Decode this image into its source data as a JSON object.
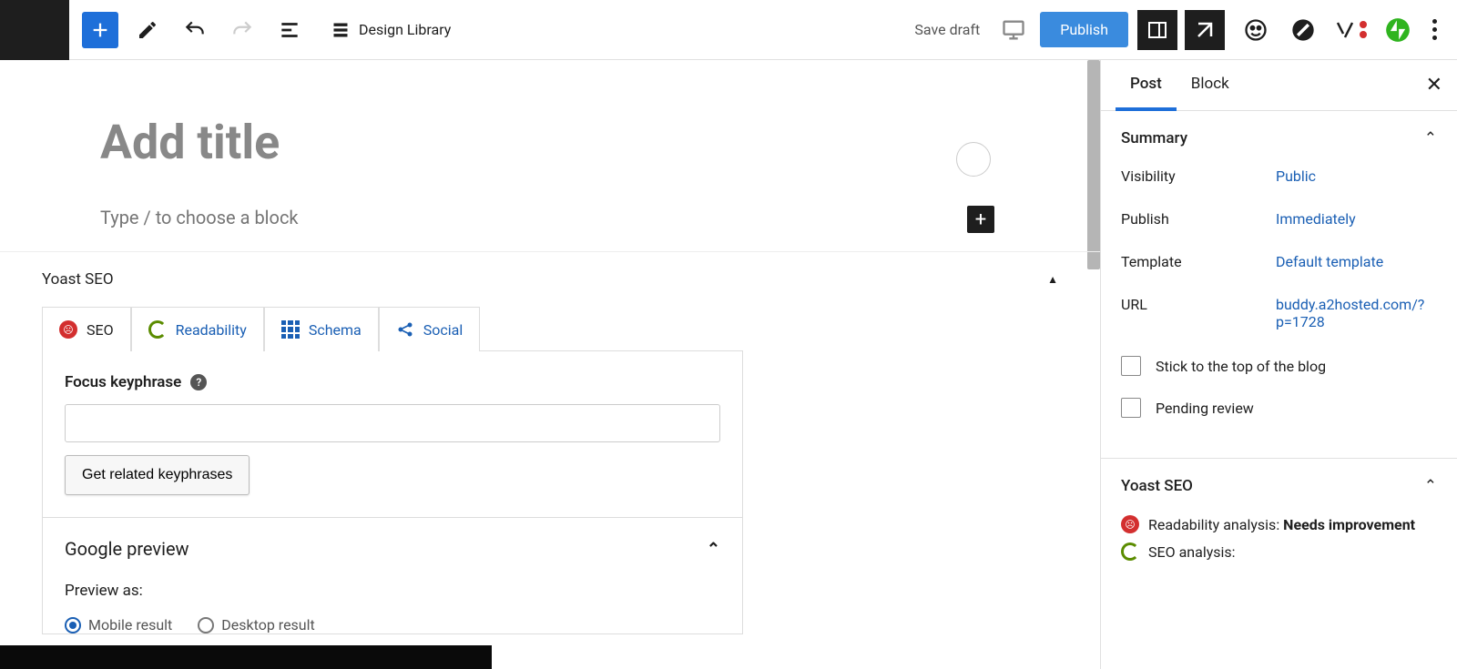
{
  "toolbar": {
    "design_library": "Design Library",
    "save_draft": "Save draft",
    "publish": "Publish"
  },
  "editor": {
    "title_placeholder": "Add title",
    "block_prompt": "Type / to choose a block"
  },
  "yoast": {
    "panel_title": "Yoast SEO",
    "tabs": {
      "seo": "SEO",
      "readability": "Readability",
      "schema": "Schema",
      "social": "Social"
    },
    "focus_label": "Focus keyphrase",
    "related_btn": "Get related keyphrases",
    "google_preview": "Google preview",
    "preview_as": "Preview as:",
    "mobile": "Mobile result",
    "desktop": "Desktop result"
  },
  "sidebar": {
    "tabs": {
      "post": "Post",
      "block": "Block"
    },
    "summary": "Summary",
    "visibility_label": "Visibility",
    "visibility_value": "Public",
    "publish_label": "Publish",
    "publish_value": "Immediately",
    "template_label": "Template",
    "template_value": "Default template",
    "url_label": "URL",
    "url_value": "buddy.a2hosted.com/?p=1728",
    "stick": "Stick to the top of the blog",
    "pending": "Pending review",
    "yoast_title": "Yoast SEO",
    "readability_label": "Readability analysis: ",
    "readability_status": "Needs improvement",
    "seo_label": "SEO analysis:"
  }
}
